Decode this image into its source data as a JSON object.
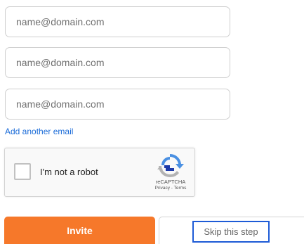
{
  "form": {
    "email_fields": [
      {
        "placeholder": "name@domain.com",
        "value": ""
      },
      {
        "placeholder": "name@domain.com",
        "value": ""
      },
      {
        "placeholder": "name@domain.com",
        "value": ""
      }
    ],
    "add_another_label": "Add another email"
  },
  "recaptcha": {
    "checkbox_label": "I'm not a robot",
    "brand": "reCAPTCHA",
    "privacy_label": "Privacy",
    "separator": " - ",
    "terms_label": "Terms",
    "checked": false,
    "colors": {
      "logo_blue": "#4a90e2",
      "logo_dark_blue": "#1c3aa9",
      "logo_gray": "#b3b3b3"
    }
  },
  "actions": {
    "invite_label": "Invite",
    "skip_label": "Skip this step"
  },
  "colors": {
    "invite_bg": "#f6782a",
    "link": "#1a6bd8",
    "focus_outline": "#1e5bd6"
  }
}
